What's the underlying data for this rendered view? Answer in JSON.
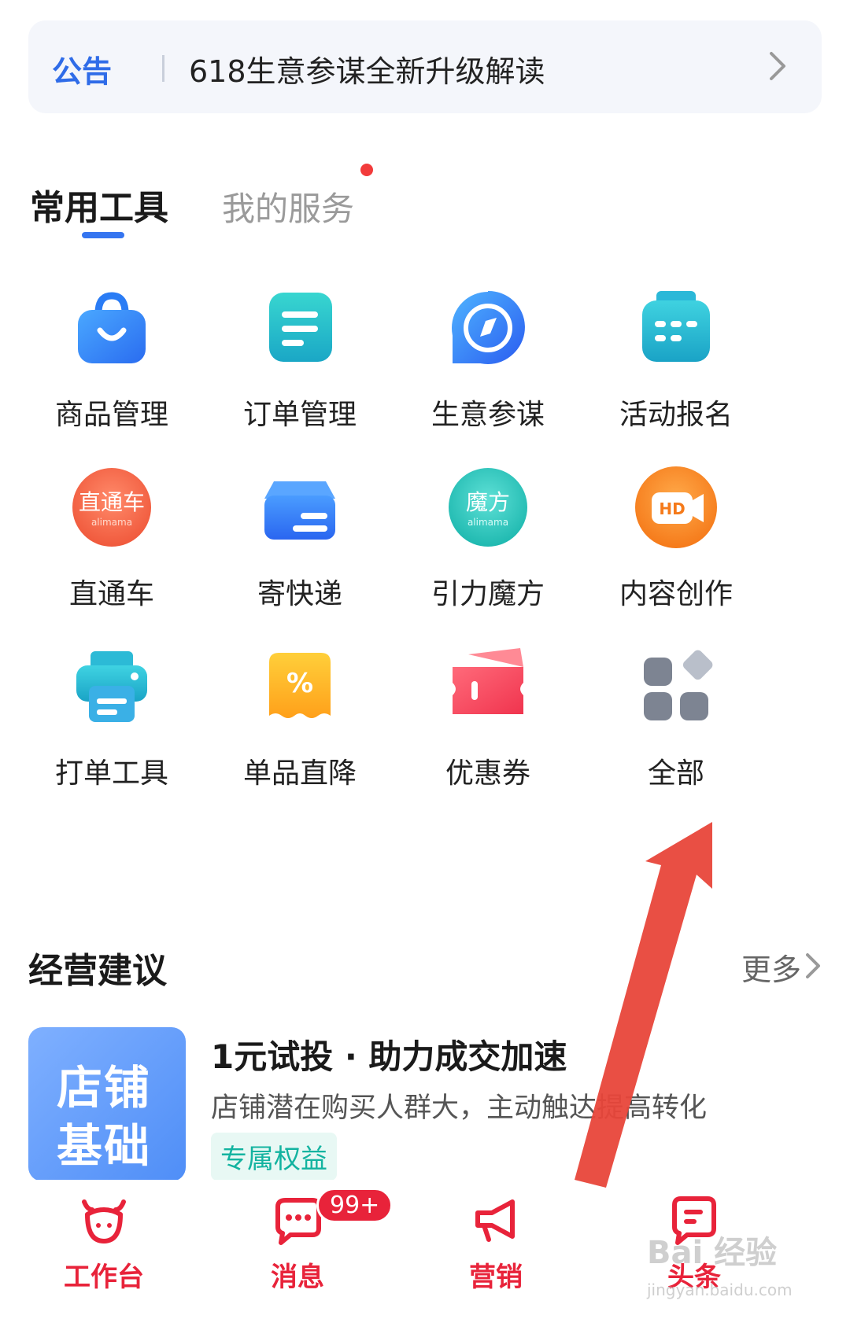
{
  "notice": {
    "label": "公告",
    "text": "618生意参谋全新升级解读"
  },
  "tabs": {
    "active": "常用工具",
    "inactive": "我的服务"
  },
  "tools": [
    {
      "label": "商品管理",
      "icon": "shopping-bag-icon"
    },
    {
      "label": "订单管理",
      "icon": "order-list-icon"
    },
    {
      "label": "生意参谋",
      "icon": "compass-icon"
    },
    {
      "label": "活动报名",
      "icon": "calendar-icon"
    },
    {
      "label": "直通车",
      "icon": "ztc-alimama-icon",
      "icon_text": "直通车",
      "icon_sub": "alimama"
    },
    {
      "label": "寄快递",
      "icon": "package-box-icon"
    },
    {
      "label": "引力魔方",
      "icon": "mofang-alimama-icon",
      "icon_text": "魔方",
      "icon_sub": "alimama"
    },
    {
      "label": "内容创作",
      "icon": "hd-video-icon",
      "icon_text": "HD"
    },
    {
      "label": "打单工具",
      "icon": "printer-icon"
    },
    {
      "label": "单品直降",
      "icon": "discount-percent-icon",
      "icon_text": "%"
    },
    {
      "label": "优惠券",
      "icon": "coupon-icon"
    },
    {
      "label": "全部",
      "icon": "all-apps-grid-icon"
    }
  ],
  "advice": {
    "title": "经营建议",
    "more": "更多",
    "card": {
      "image_line1": "店铺",
      "image_line2": "基础",
      "title": "1元试投 · 助力成交加速",
      "subtitle": "店铺潜在购买人群大，主动触达提高转化",
      "tag": "专属权益"
    }
  },
  "tabbar": [
    {
      "label": "工作台",
      "icon": "cow-head-icon"
    },
    {
      "label": "消息",
      "icon": "chat-bubble-icon",
      "badge": "99+"
    },
    {
      "label": "营销",
      "icon": "megaphone-icon"
    },
    {
      "label": "头条",
      "icon": "news-icon"
    }
  ],
  "watermark": {
    "text": "Bai 经验",
    "sub": "jingyan.baidu.com"
  },
  "colors": {
    "accent": "#3575f0",
    "tabbar_red": "#e8233a",
    "arrow": "#e8463a",
    "notice_label": "#2f6ce8"
  }
}
